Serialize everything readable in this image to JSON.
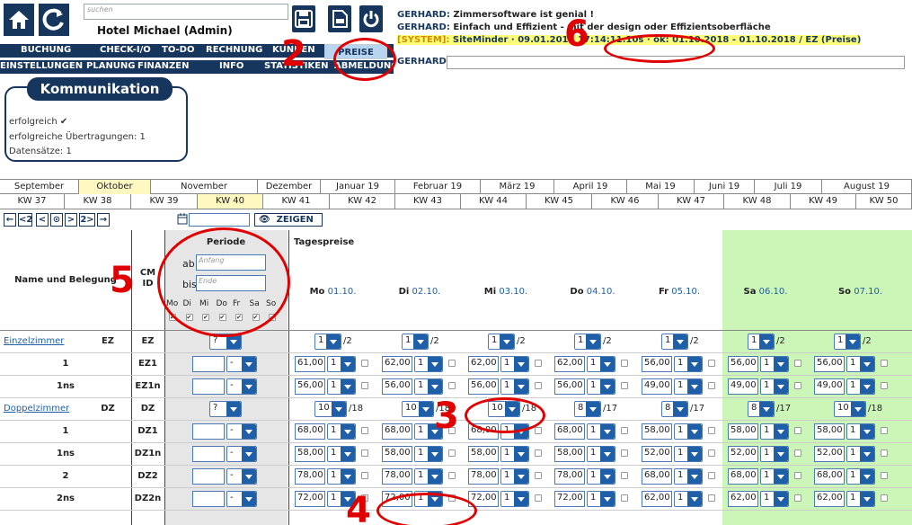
{
  "header": {
    "search_placeholder": "suchen",
    "hotel_name": "Hotel Michael (Admin)",
    "menu_row1": [
      "BUCHUNG",
      "CHECK-I/O",
      "TO-DO",
      "RECHNUNG",
      "KUNDEN"
    ],
    "menu_row2": [
      "EINSTELLUNGEN",
      "PLANUNG",
      "FINANZEN",
      "INFO",
      "STATISTIKEN",
      "ABMELDUNG"
    ],
    "preise_label": "PREISE"
  },
  "messages": [
    {
      "sender": "GERHARD:",
      "text": "Zimmersoftware ist genial !"
    },
    {
      "sender": "GERHARD:",
      "text": "Einfach und Effizient - mit der design oder Effizientsoberfläche"
    },
    {
      "sender": "[SYSTEM]:",
      "text": "SiteMinder · 09.01.2018 17:14:11.10s · ok: 01.10.2018 - 01.10.2018 / EZ (Preise)"
    },
    {
      "sender": "GERHARD:",
      "text": ""
    }
  ],
  "kommunikation": {
    "title": "Kommunikation",
    "status": "erfolgreich ✔",
    "transfers": "erfolgreiche Übertragungen: 1",
    "records": "Datensätze: 1"
  },
  "months": [
    "September",
    "Oktober",
    "November",
    "Dezember",
    "Januar 19",
    "Februar 19",
    "März 19",
    "April 19",
    "Mai 19",
    "Juni 19",
    "Juli 19",
    "August 19"
  ],
  "weeks": [
    "KW 37",
    "KW 38",
    "KW 39",
    "KW 40",
    "KW 41",
    "KW 42",
    "KW 43",
    "KW 44",
    "KW 45",
    "KW 46",
    "KW 47",
    "KW 48",
    "KW 49",
    "KW 50"
  ],
  "toolbar": {
    "nav": [
      "←",
      "<2",
      "<",
      "⊙",
      ">",
      "2>",
      "→"
    ],
    "date_placeholder": "",
    "show_label": "ZEIGEN"
  },
  "table": {
    "col_name": "Name und Belegung",
    "col_cm": "CM",
    "col_id": "ID",
    "periode": "Periode",
    "ab_label": "ab",
    "bis_label": "bis",
    "anfang_placeholder": "Anfang",
    "ende_placeholder": "Ende",
    "weekdays_short": [
      "Mo",
      "Di",
      "Mi",
      "Do",
      "Fr",
      "Sa",
      "So"
    ],
    "tagespreise": "Tagespreise",
    "days": [
      {
        "wd": "Mo",
        "date": "01.10.",
        "weekend": false
      },
      {
        "wd": "Di",
        "date": "02.10.",
        "weekend": false
      },
      {
        "wd": "Mi",
        "date": "03.10.",
        "weekend": false
      },
      {
        "wd": "Do",
        "date": "04.10.",
        "weekend": false
      },
      {
        "wd": "Fr",
        "date": "05.10.",
        "weekend": false
      },
      {
        "wd": "Sa",
        "date": "06.10.",
        "weekend": true
      },
      {
        "wd": "So",
        "date": "07.10.",
        "weekend": true
      }
    ],
    "rows": [
      {
        "name": "Einzelzimmer",
        "cm": "EZ",
        "id": "EZ",
        "type": "category",
        "period_sel": "?",
        "avail": [
          "1",
          "1",
          "1",
          "1",
          "1",
          "1",
          "1"
        ],
        "total": [
          "/2",
          "/2",
          "/2",
          "/2",
          "/2",
          "/2",
          "/2"
        ]
      },
      {
        "name": "1",
        "cm": "",
        "id": "EZ1",
        "type": "price",
        "period_sel": "-",
        "prices": [
          "61,00",
          "62,00",
          "62,00",
          "62,00",
          "56,00",
          "56,00",
          "56,00"
        ],
        "qty": [
          "1",
          "1",
          "1",
          "1",
          "1",
          "1",
          "1"
        ]
      },
      {
        "name": "1ns",
        "cm": "",
        "id": "EZ1n",
        "type": "price",
        "period_sel": "-",
        "prices": [
          "56,00",
          "56,00",
          "56,00",
          "56,00",
          "49,00",
          "49,00",
          "49,00"
        ],
        "qty": [
          "1",
          "1",
          "1",
          "1",
          "1",
          "1",
          "1"
        ]
      },
      {
        "name": "Doppelzimmer",
        "cm": "DZ",
        "id": "DZ",
        "type": "category",
        "period_sel": "?",
        "avail": [
          "10",
          "10",
          "10",
          "8",
          "8",
          "8",
          "10"
        ],
        "total": [
          "/18",
          "/18",
          "/18",
          "/17",
          "/17",
          "/17",
          "/18"
        ]
      },
      {
        "name": "1",
        "cm": "",
        "id": "DZ1",
        "type": "price",
        "period_sel": "-",
        "prices": [
          "68,00",
          "68,00",
          "68,00",
          "68,00",
          "58,00",
          "58,00",
          "58,00"
        ],
        "qty": [
          "1",
          "1",
          "1",
          "1",
          "1",
          "1",
          "1"
        ]
      },
      {
        "name": "1ns",
        "cm": "",
        "id": "DZ1n",
        "type": "price",
        "period_sel": "-",
        "prices": [
          "58,00",
          "58,00",
          "58,00",
          "58,00",
          "52,00",
          "52,00",
          "52,00"
        ],
        "qty": [
          "1",
          "1",
          "1",
          "1",
          "1",
          "1",
          "1"
        ]
      },
      {
        "name": "2",
        "cm": "",
        "id": "DZ2",
        "type": "price",
        "period_sel": "-",
        "prices": [
          "78,00",
          "78,00",
          "78,00",
          "78,00",
          "68,00",
          "68,00",
          "68,00"
        ],
        "qty": [
          "1",
          "1",
          "1",
          "1",
          "1",
          "1",
          "1"
        ]
      },
      {
        "name": "2ns",
        "cm": "",
        "id": "DZ2n",
        "type": "price",
        "period_sel": "-",
        "prices": [
          "72,00",
          "72,00",
          "72,00",
          "72,00",
          "62,00",
          "62,00",
          "62,00"
        ],
        "qty": [
          "1",
          "1",
          "1",
          "1",
          "1",
          "1",
          "1"
        ]
      }
    ]
  },
  "annotations": [
    "2",
    "3",
    "4",
    "5",
    "6"
  ],
  "colors": {
    "navy": "#17365d",
    "weekend": "#ccf5b8",
    "periode_bg": "#e6e6e6",
    "active_month": "#fff8c0",
    "annotation": "#e00000"
  }
}
